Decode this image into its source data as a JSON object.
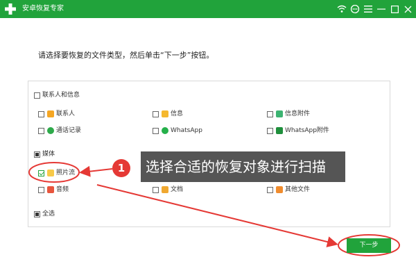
{
  "window": {
    "title": "安卓恢复专家"
  },
  "instruction": "请选择要恢复的文件类型，然后单击“下一步”按钮。",
  "sections": {
    "contacts": {
      "label": "联系人和信息",
      "items": [
        "联系人",
        "信息",
        "信息附件",
        "通话记录",
        "WhatsApp",
        "WhatsApp附件"
      ]
    },
    "media": {
      "label": "媒体",
      "items": [
        "照片流",
        "音频",
        "文档",
        "其他文件"
      ]
    },
    "select_all": "全选"
  },
  "callout": {
    "number": "1",
    "text": "选择合适的恢复对象进行扫描"
  },
  "next_button": "下一步",
  "colors": {
    "brand_green": "#21a33b",
    "annotation_red": "#e53935"
  }
}
